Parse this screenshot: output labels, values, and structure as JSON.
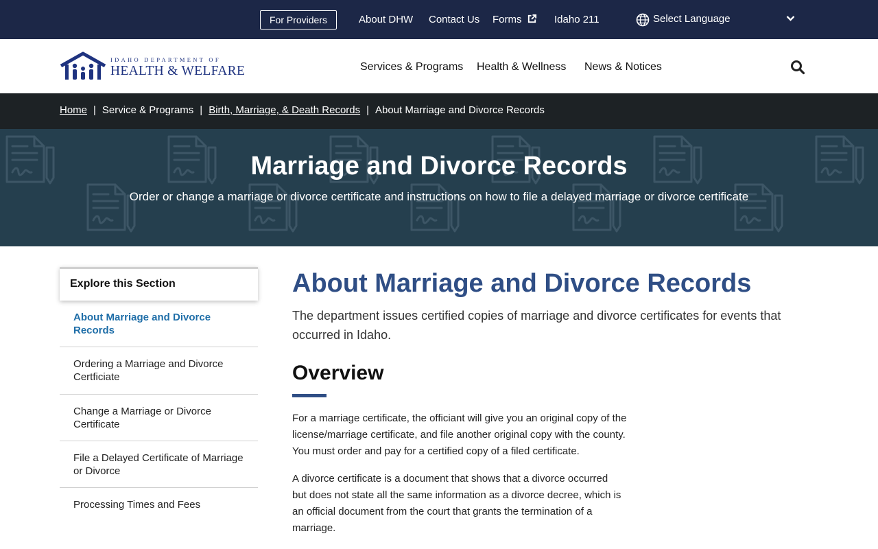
{
  "utility": {
    "providers_label": "For Providers",
    "links": [
      "About DHW",
      "Contact Us",
      "Forms",
      "Idaho 211"
    ],
    "language_label": "Select Language"
  },
  "header": {
    "logo_small": "IDAHO DEPARTMENT OF",
    "logo_big": "HEALTH & WELFARE",
    "nav": [
      "Services & Programs",
      "Health & Wellness",
      "News & Notices"
    ]
  },
  "breadcrumb": {
    "home": "Home",
    "section": "Service & Programs",
    "parent": "Birth, Marriage, & Death Records",
    "current": "About Marriage and Divorce Records"
  },
  "hero": {
    "title": "Marriage and Divorce Records",
    "subtitle": "Order or change a marriage or divorce certificate and instructions on how to file a delayed marriage or divorce certificate"
  },
  "sidebar": {
    "heading": "Explore this Section",
    "items": [
      {
        "label": "About Marriage and Divorce Records",
        "active": true
      },
      {
        "label": "Ordering a Marriage and Divorce Certficiate",
        "active": false
      },
      {
        "label": "Change a Marriage or Divorce Certificate",
        "active": false
      },
      {
        "label": "File a Delayed Certificate of Marriage or Divorce",
        "active": false
      },
      {
        "label": "Processing Times and Fees",
        "active": false
      }
    ]
  },
  "main": {
    "title": "About Marriage and Divorce Records",
    "lead": "The department issues certified copies of marriage and divorce certificates for events that occurred in Idaho.",
    "overview_heading": "Overview",
    "paragraphs": [
      "For a marriage certificate, the officiant will give you an original copy of the license/marriage certificate, and file another original copy with the county. You must order and pay for a certified copy of a filed certificate.",
      "A divorce certificate is a document that shows that a divorce occurred but does not state all the same information as a divorce decree, which is an official document from the court that grants the termination of a marriage."
    ]
  },
  "colors": {
    "utility_bg": "#1c2747",
    "breadcrumb_bg": "#1d2225",
    "hero_bg": "#253f4e",
    "heading_blue": "#2f4e85",
    "active_link": "#1f6ea8",
    "logo_blue": "#1f3380"
  },
  "icons": [
    "external-link-icon",
    "globe-icon",
    "chevron-down-icon",
    "search-icon",
    "dhw-logo-icon",
    "document-pattern-icon"
  ]
}
